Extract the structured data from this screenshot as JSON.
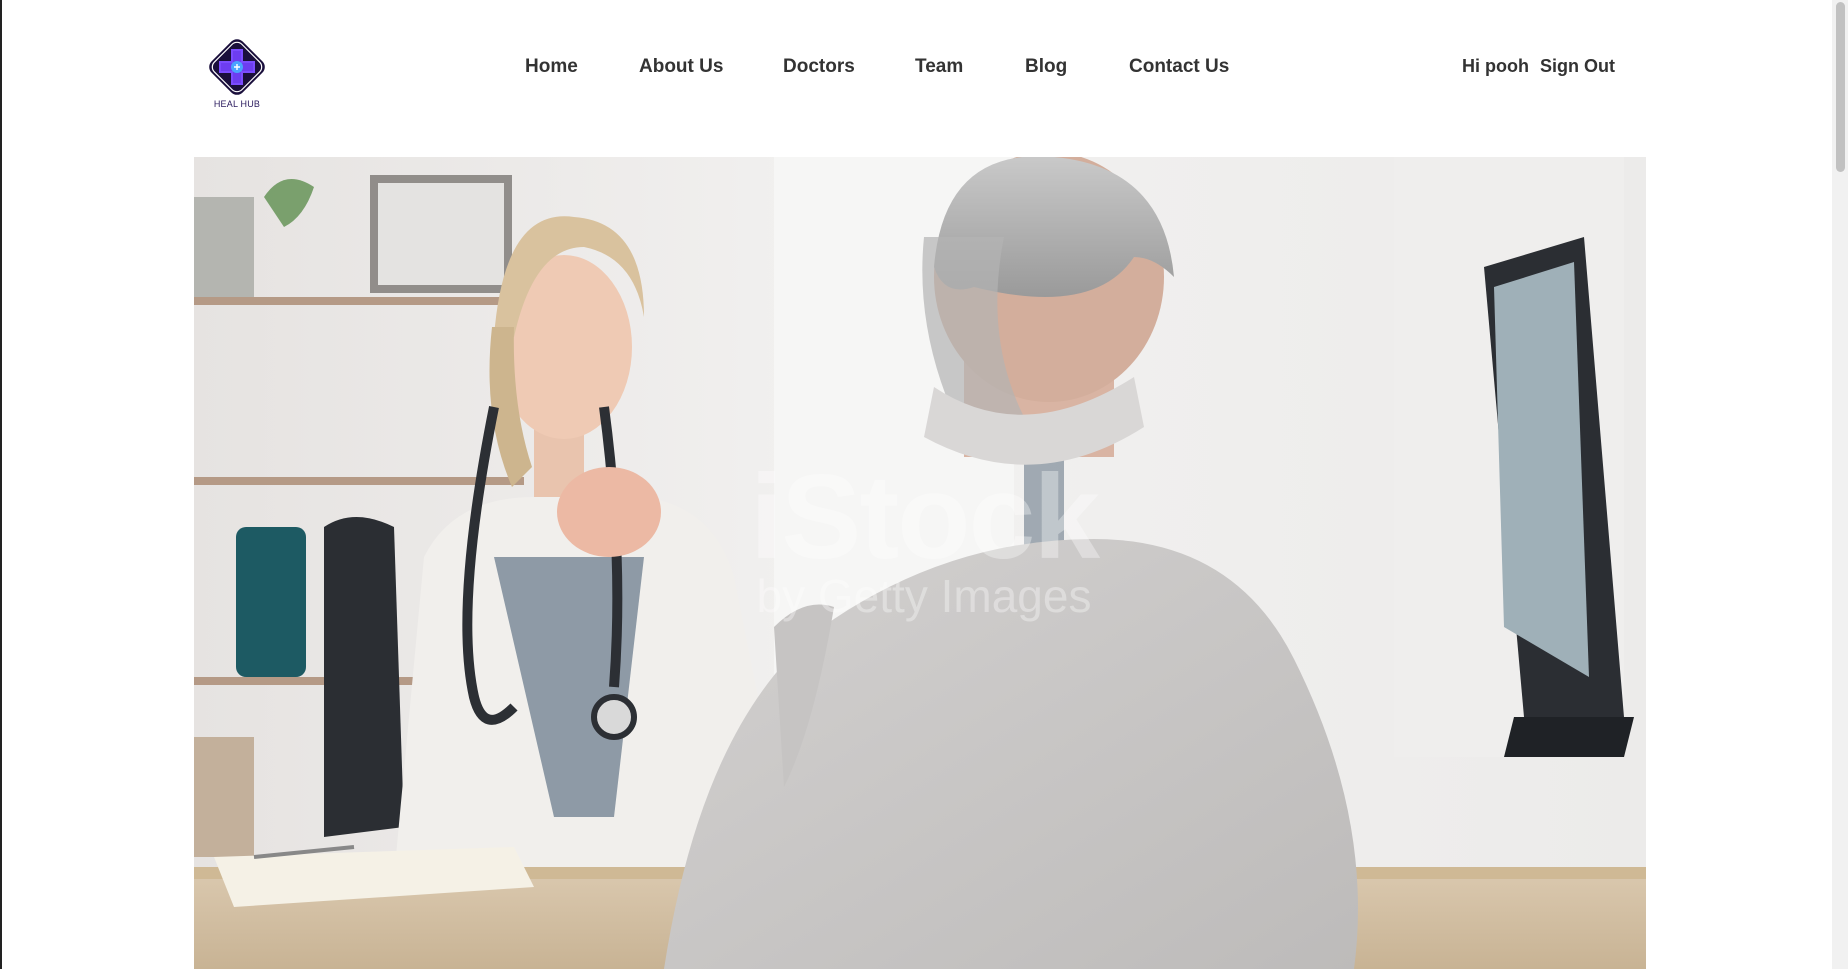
{
  "brand": {
    "name": "HEAL HUB",
    "colors": {
      "primary": "#3a1c8c",
      "accent": "#3d7bf0",
      "dark": "#1a0f3c"
    }
  },
  "nav": {
    "items": [
      {
        "label": "Home"
      },
      {
        "label": "About Us"
      },
      {
        "label": "Doctors"
      },
      {
        "label": "Team"
      },
      {
        "label": "Blog"
      },
      {
        "label": "Contact Us"
      }
    ]
  },
  "user": {
    "greeting": "Hi pooh",
    "signout_label": "Sign Out"
  },
  "hero": {
    "image_alt": "Doctor consulting with an elderly patient",
    "watermark_line1": "iStock",
    "watermark_line2": "by Getty Images"
  }
}
